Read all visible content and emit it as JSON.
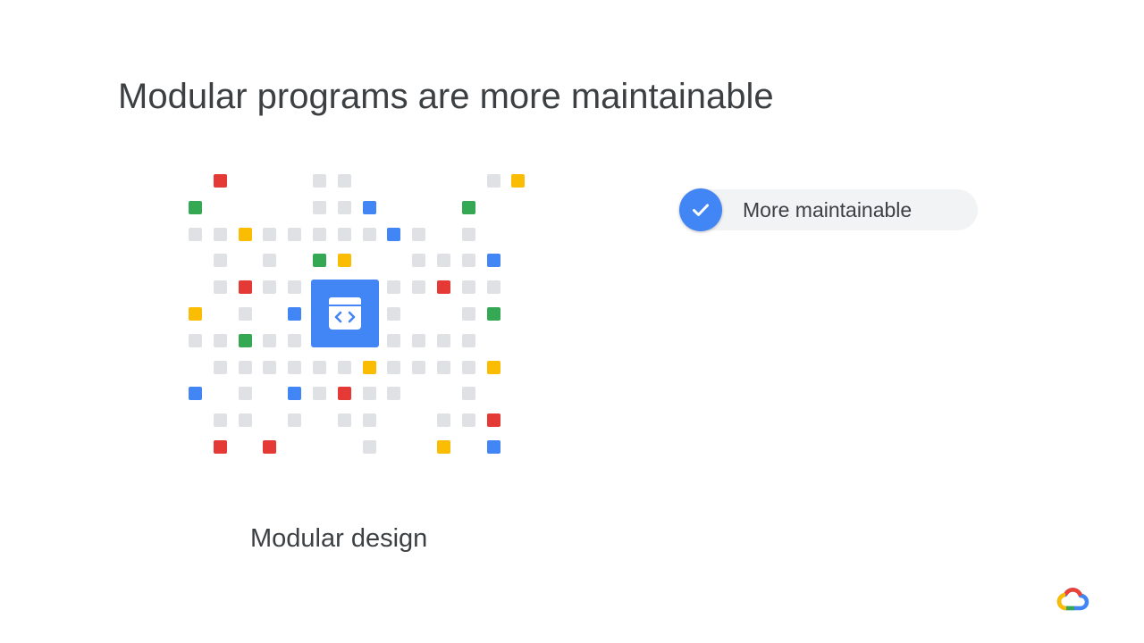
{
  "slide": {
    "title": "Modular programs are more maintainable",
    "caption": "Modular design",
    "badge_label": "More maintainable"
  },
  "icons": {
    "check": "check-icon",
    "module": "code-brackets-icon",
    "logo": "google-cloud-logo"
  },
  "colors": {
    "blue": "#4285f4",
    "red": "#e53935",
    "green": "#34a853",
    "yellow": "#fbbc04",
    "gray": "#dfe1e5",
    "pill_background": "#f1f3f4",
    "text": "#3c4043"
  },
  "grid": {
    "cells": [
      [
        0,
        1,
        "r"
      ],
      [
        0,
        5,
        "g"
      ],
      [
        0,
        6,
        "g"
      ],
      [
        0,
        12,
        "g"
      ],
      [
        0,
        13,
        "y"
      ],
      [
        1,
        0,
        "G"
      ],
      [
        1,
        5,
        "g"
      ],
      [
        1,
        6,
        "g"
      ],
      [
        1,
        7,
        "b"
      ],
      [
        1,
        11,
        "G"
      ],
      [
        2,
        0,
        "g"
      ],
      [
        2,
        1,
        "g"
      ],
      [
        2,
        2,
        "y"
      ],
      [
        2,
        3,
        "g"
      ],
      [
        2,
        4,
        "g"
      ],
      [
        2,
        5,
        "g"
      ],
      [
        2,
        6,
        "g"
      ],
      [
        2,
        7,
        "g"
      ],
      [
        2,
        8,
        "b"
      ],
      [
        2,
        9,
        "g"
      ],
      [
        2,
        11,
        "g"
      ],
      [
        3,
        1,
        "g"
      ],
      [
        3,
        3,
        "g"
      ],
      [
        3,
        5,
        "G"
      ],
      [
        3,
        6,
        "y"
      ],
      [
        3,
        9,
        "g"
      ],
      [
        3,
        10,
        "g"
      ],
      [
        3,
        11,
        "g"
      ],
      [
        3,
        12,
        "b"
      ],
      [
        4,
        1,
        "g"
      ],
      [
        4,
        2,
        "r"
      ],
      [
        4,
        3,
        "g"
      ],
      [
        4,
        4,
        "g"
      ],
      [
        4,
        8,
        "g"
      ],
      [
        4,
        9,
        "g"
      ],
      [
        4,
        10,
        "r"
      ],
      [
        4,
        11,
        "g"
      ],
      [
        4,
        12,
        "g"
      ],
      [
        5,
        0,
        "y"
      ],
      [
        5,
        2,
        "g"
      ],
      [
        5,
        4,
        "b"
      ],
      [
        5,
        8,
        "g"
      ],
      [
        5,
        11,
        "g"
      ],
      [
        5,
        12,
        "G"
      ],
      [
        6,
        0,
        "g"
      ],
      [
        6,
        1,
        "g"
      ],
      [
        6,
        2,
        "G"
      ],
      [
        6,
        3,
        "g"
      ],
      [
        6,
        4,
        "g"
      ],
      [
        6,
        8,
        "g"
      ],
      [
        6,
        9,
        "g"
      ],
      [
        6,
        10,
        "g"
      ],
      [
        6,
        11,
        "g"
      ],
      [
        7,
        1,
        "g"
      ],
      [
        7,
        2,
        "g"
      ],
      [
        7,
        3,
        "g"
      ],
      [
        7,
        4,
        "g"
      ],
      [
        7,
        5,
        "g"
      ],
      [
        7,
        6,
        "g"
      ],
      [
        7,
        7,
        "y"
      ],
      [
        7,
        8,
        "g"
      ],
      [
        7,
        9,
        "g"
      ],
      [
        7,
        10,
        "g"
      ],
      [
        7,
        11,
        "g"
      ],
      [
        7,
        12,
        "y"
      ],
      [
        8,
        0,
        "b"
      ],
      [
        8,
        2,
        "g"
      ],
      [
        8,
        4,
        "b"
      ],
      [
        8,
        5,
        "g"
      ],
      [
        8,
        6,
        "r"
      ],
      [
        8,
        7,
        "g"
      ],
      [
        8,
        8,
        "g"
      ],
      [
        8,
        11,
        "g"
      ],
      [
        9,
        1,
        "g"
      ],
      [
        9,
        2,
        "g"
      ],
      [
        9,
        4,
        "g"
      ],
      [
        9,
        6,
        "g"
      ],
      [
        9,
        7,
        "g"
      ],
      [
        9,
        10,
        "g"
      ],
      [
        9,
        11,
        "g"
      ],
      [
        9,
        12,
        "r"
      ],
      [
        10,
        1,
        "r"
      ],
      [
        10,
        3,
        "r"
      ],
      [
        10,
        7,
        "g"
      ],
      [
        10,
        10,
        "y"
      ],
      [
        10,
        12,
        "b"
      ]
    ]
  }
}
